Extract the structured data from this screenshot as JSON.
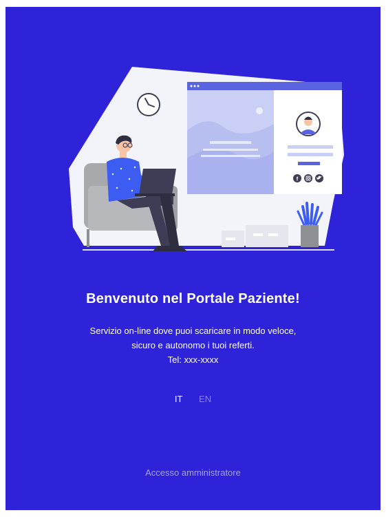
{
  "welcome": {
    "title": "Benvenuto nel Portale Paziente!",
    "description_line1": "Servizio on-line dove puoi scaricare in modo veloce,",
    "description_line2": "sicuro e autonomo i tuoi referti.",
    "phone": "Tel: xxx-xxxx"
  },
  "language": {
    "options": [
      "IT",
      "EN"
    ],
    "selected": "IT"
  },
  "admin_link": "Accesso amministratore",
  "colors": {
    "background": "#2e23d8",
    "accent": "#5a64e0",
    "text": "#ffffff"
  },
  "icons": {
    "illustration": "person-at-laptop-illustration",
    "clock": "clock-icon",
    "facebook": "facebook-icon",
    "instagram": "instagram-icon",
    "twitter": "twitter-icon"
  }
}
